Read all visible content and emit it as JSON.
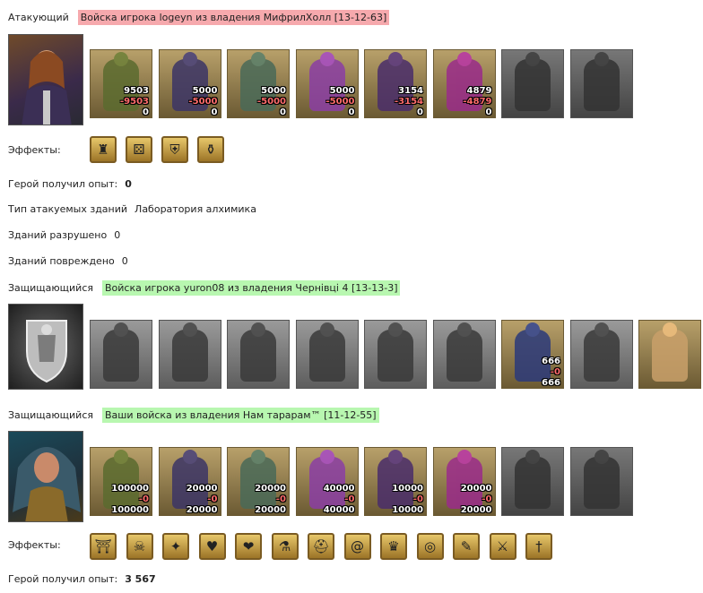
{
  "attacker": {
    "label": "Атакующий",
    "title": "Войска игрока logeyn из владения МифрилХолл [13-12-63]",
    "hero_icon": "hero-portrait-icon",
    "units": [
      {
        "icon": "orc-warrior-icon",
        "style": "color",
        "color": "#5b6b2f",
        "n1": "9503",
        "n2": "-9503",
        "n3": "0"
      },
      {
        "icon": "assassin-icon",
        "style": "color",
        "color": "#3c3566",
        "n1": "5000",
        "n2": "-5000",
        "n3": "0"
      },
      {
        "icon": "lizard-rider-icon",
        "style": "color",
        "color": "#4a6a58",
        "n1": "5000",
        "n2": "-5000",
        "n3": "0"
      },
      {
        "icon": "harpy-icon",
        "style": "color",
        "color": "#8b3ea4",
        "n1": "5000",
        "n2": "-5000",
        "n3": "0"
      },
      {
        "icon": "dark-archer-icon",
        "style": "color",
        "color": "#4a2d6a",
        "n1": "3154",
        "n2": "-3154",
        "n3": "0"
      },
      {
        "icon": "sorceress-icon",
        "style": "color",
        "color": "#9a2b8a",
        "n1": "4879",
        "n2": "-4879",
        "n3": "0"
      },
      {
        "icon": "shadow-icon",
        "style": "gray",
        "color": "#333333",
        "n1": "",
        "n2": "",
        "n3": ""
      },
      {
        "icon": "spider-knight-icon",
        "style": "gray",
        "color": "#333333",
        "n1": "",
        "n2": "",
        "n3": ""
      }
    ],
    "effects_label": "Эффекты:",
    "effects": [
      {
        "icon": "castle-icon",
        "glyph": "♜"
      },
      {
        "icon": "dice-icon",
        "glyph": "⚄"
      },
      {
        "icon": "shield-icon",
        "glyph": "⛨"
      },
      {
        "icon": "bag-icon",
        "glyph": "⚱"
      }
    ],
    "exp_label": "Герой получил опыт:",
    "exp_value": "0",
    "building_type_label": "Тип атакуемых зданий",
    "building_type_value": "Лаборатория алхимика",
    "destroyed_label": "Зданий разрушено",
    "destroyed_value": "0",
    "damaged_label": "Зданий повреждено",
    "damaged_value": "0"
  },
  "defender1": {
    "label": "Защищающийся",
    "title": "Войска игрока yuron08 из владения Чернівці 4 [13-13-3]",
    "hero_icon": "coat-of-arms-icon",
    "units": [
      {
        "icon": "cart-icon",
        "style": "gray2",
        "color": "#3a3a3a",
        "n1": "",
        "n2": "",
        "n3": ""
      },
      {
        "icon": "spearman-icon",
        "style": "gray2",
        "color": "#3a3a3a",
        "n1": "",
        "n2": "",
        "n3": ""
      },
      {
        "icon": "knight-rider-icon",
        "style": "gray2",
        "color": "#3a3a3a",
        "n1": "",
        "n2": "",
        "n3": ""
      },
      {
        "icon": "pegasus-icon",
        "style": "gray2",
        "color": "#3a3a3a",
        "n1": "",
        "n2": "",
        "n3": ""
      },
      {
        "icon": "crossbowman-icon",
        "style": "gray2",
        "color": "#3a3a3a",
        "n1": "",
        "n2": "",
        "n3": ""
      },
      {
        "icon": "monk-icon",
        "style": "gray2",
        "color": "#3a3a3a",
        "n1": "",
        "n2": "",
        "n3": ""
      },
      {
        "icon": "guardian-icon",
        "style": "color",
        "color": "#2b3a7a",
        "n1": "666",
        "n2": "-0",
        "n3": "666"
      },
      {
        "icon": "angel-icon",
        "style": "gray2",
        "color": "#3a3a3a",
        "n1": "",
        "n2": "",
        "n3": ""
      },
      {
        "icon": "tower-icon",
        "style": "color",
        "color": "#c9a06a",
        "n1": "",
        "n2": "",
        "n3": ""
      }
    ]
  },
  "defender2": {
    "label": "Защищающийся",
    "title": "Ваши войска из владения Нам тарарам™ [11-12-55]",
    "hero_icon": "hero-portrait-icon",
    "units": [
      {
        "icon": "orc-warrior-icon",
        "style": "color",
        "color": "#5b6b2f",
        "n1": "100000",
        "n2": "-0",
        "n3": "100000"
      },
      {
        "icon": "assassin-icon",
        "style": "color",
        "color": "#3c3566",
        "n1": "20000",
        "n2": "-0",
        "n3": "20000"
      },
      {
        "icon": "lizard-rider-icon",
        "style": "color",
        "color": "#4a6a58",
        "n1": "20000",
        "n2": "-0",
        "n3": "20000"
      },
      {
        "icon": "harpy-icon",
        "style": "color",
        "color": "#8b3ea4",
        "n1": "40000",
        "n2": "-0",
        "n3": "40000"
      },
      {
        "icon": "dark-archer-icon",
        "style": "color",
        "color": "#4a2d6a",
        "n1": "10000",
        "n2": "-0",
        "n3": "10000"
      },
      {
        "icon": "sorceress-icon",
        "style": "color",
        "color": "#9a2b8a",
        "n1": "20000",
        "n2": "-0",
        "n3": "20000"
      },
      {
        "icon": "shadow-icon",
        "style": "gray",
        "color": "#333333",
        "n1": "",
        "n2": "",
        "n3": ""
      },
      {
        "icon": "spider-knight-icon",
        "style": "gray",
        "color": "#333333",
        "n1": "",
        "n2": "",
        "n3": ""
      }
    ],
    "effects_label": "Эффекты:",
    "effects": [
      {
        "icon": "gate-icon",
        "glyph": "⛩"
      },
      {
        "icon": "skull-icon",
        "glyph": "☠"
      },
      {
        "icon": "wand-icon",
        "glyph": "✦"
      },
      {
        "icon": "heart-icon",
        "glyph": "♥"
      },
      {
        "icon": "heart-plus-icon",
        "glyph": "❤"
      },
      {
        "icon": "potion-icon",
        "glyph": "⚗"
      },
      {
        "icon": "helmet-icon",
        "glyph": "⛑"
      },
      {
        "icon": "spiral-icon",
        "glyph": "@"
      },
      {
        "icon": "armor-icon",
        "glyph": "♛"
      },
      {
        "icon": "ring-icon",
        "glyph": "◎"
      },
      {
        "icon": "scroll-icon",
        "glyph": "✎"
      },
      {
        "icon": "knight-shield-icon",
        "glyph": "⚔"
      },
      {
        "icon": "sword-icon",
        "glyph": "†"
      }
    ],
    "exp_label": "Герой получил опыт:",
    "exp_value": "3 567"
  }
}
